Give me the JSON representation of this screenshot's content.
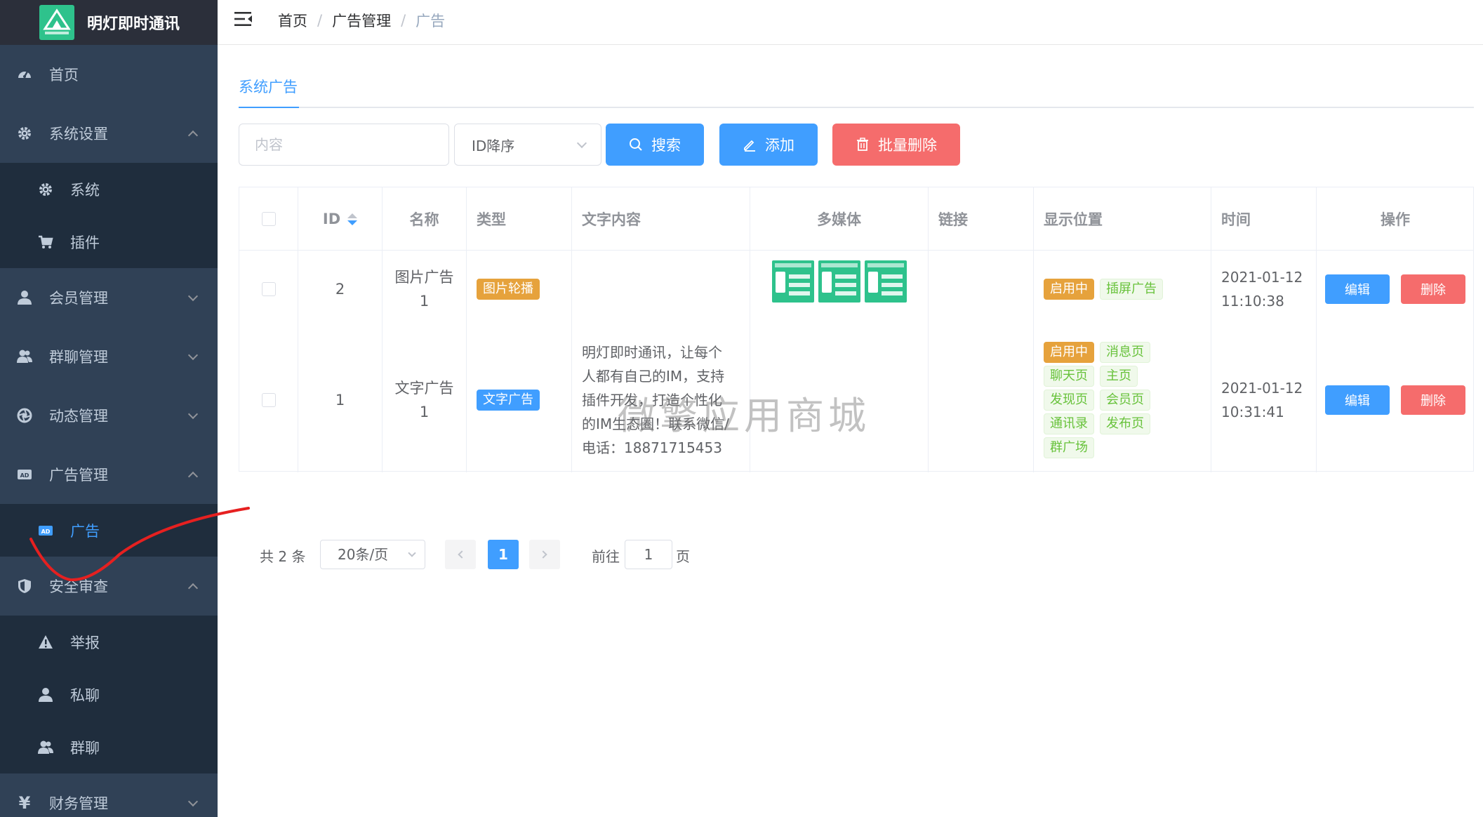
{
  "app": {
    "title": "明灯即时通讯",
    "accent_color": "#409eff",
    "danger_color": "#f56c6c",
    "sidebar_bg": "#304156",
    "logo_icon": "app-logo-icon"
  },
  "sidebar": {
    "items": [
      {
        "label": "首页",
        "icon": "dashboard-icon"
      },
      {
        "label": "系统设置",
        "icon": "gear-icon",
        "expanded": true
      },
      {
        "label": "系统",
        "icon": "gear-icon",
        "sub": true
      },
      {
        "label": "插件",
        "icon": "cart-icon",
        "sub": true
      },
      {
        "label": "会员管理",
        "icon": "user-icon",
        "expanded": false
      },
      {
        "label": "群聊管理",
        "icon": "users-icon",
        "expanded": false
      },
      {
        "label": "动态管理",
        "icon": "aperture-icon",
        "expanded": false
      },
      {
        "label": "广告管理",
        "icon": "ad-icon",
        "expanded": true
      },
      {
        "label": "广告",
        "icon": "ad-icon",
        "sub": true,
        "active": true
      },
      {
        "label": "安全审查",
        "icon": "shield-icon",
        "expanded": true
      },
      {
        "label": "举报",
        "icon": "warning-icon",
        "sub": true
      },
      {
        "label": "私聊",
        "icon": "user-icon",
        "sub": true
      },
      {
        "label": "群聊",
        "icon": "users-icon",
        "sub": true
      },
      {
        "label": "财务管理",
        "icon": "yen-icon",
        "expanded": false
      }
    ]
  },
  "header": {
    "menu_icon": "hamburger-fold-icon",
    "breadcrumb": [
      "首页",
      "广告管理",
      "广告"
    ]
  },
  "tabs": [
    {
      "label": "系统广告",
      "active": true
    }
  ],
  "toolbar": {
    "search_placeholder": "内容",
    "sort_value": "ID降序",
    "search_label": "搜索",
    "add_label": "添加",
    "batch_delete_label": "批量删除"
  },
  "table": {
    "columns": [
      "ID",
      "名称",
      "类型",
      "文字内容",
      "多媒体",
      "链接",
      "显示位置",
      "时间",
      "操作"
    ],
    "rows": [
      {
        "id": "2",
        "name_line1": "图片广告",
        "name_line2": "1",
        "type": "图片轮播",
        "text": "",
        "media_count": 3,
        "link": "",
        "positions": [
          "启用中",
          "插屏广告"
        ],
        "date": "2021-01-12",
        "time": "11:10:38",
        "edit": "编辑",
        "delete": "删除"
      },
      {
        "id": "1",
        "name_line1": "文字广告",
        "name_line2": "1",
        "type": "文字广告",
        "text_lines": [
          "明灯即时通讯，让每个",
          "人都有自己的IM，支持",
          "插件开发，打造个性化",
          "的IM生态圈！联系微信/",
          "电话：18871715453"
        ],
        "media_count": 0,
        "link": "",
        "positions": [
          "启用中",
          "消息页",
          "聊天页",
          "主页",
          "发现页",
          "会员页",
          "通讯录",
          "发布页",
          "群广场"
        ],
        "date": "2021-01-12",
        "time": "10:31:41",
        "edit": "编辑",
        "delete": "删除"
      }
    ]
  },
  "pagination": {
    "total": "共 2 条",
    "page_size": "20条/页",
    "current_page": "1",
    "goto_label": "前往",
    "goto_value": "1",
    "page_label": "页"
  },
  "watermark": "微擎应用商城"
}
